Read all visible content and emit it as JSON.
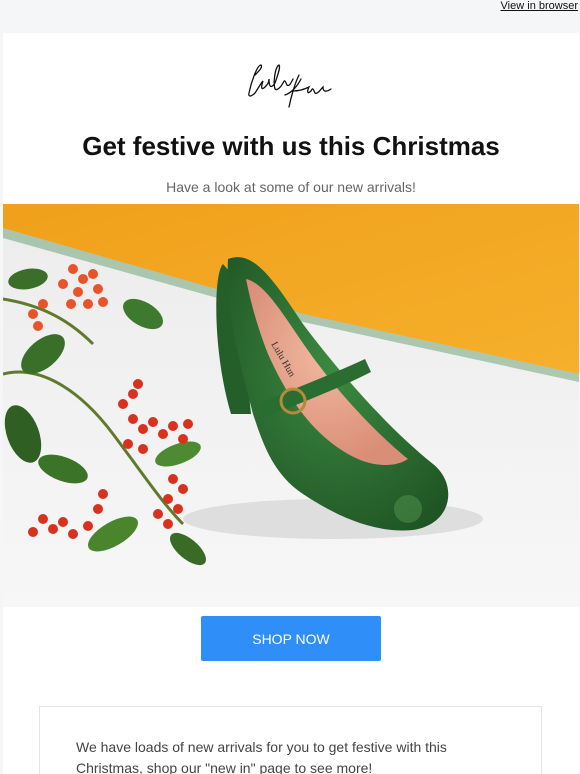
{
  "topbar": {
    "view_in_browser": "View in browser"
  },
  "header": {
    "logo_name": "lulu-hun-signature-logo"
  },
  "main": {
    "headline": "Get festive with us this Christmas",
    "subline": "Have a look at some of our new arrivals!",
    "hero_image": "green-mary-jane-shoe-with-berries",
    "cta_label": "SHOP NOW",
    "info_text": "We have loads of new arrivals for you to get festive with this Christmas, shop our \"new in\" page to see more!"
  },
  "colors": {
    "accent": "#2f8ef8",
    "hero_wall": "#f1a51d",
    "shoe_green": "#2d6b32",
    "berry_red": "#d8321e"
  }
}
